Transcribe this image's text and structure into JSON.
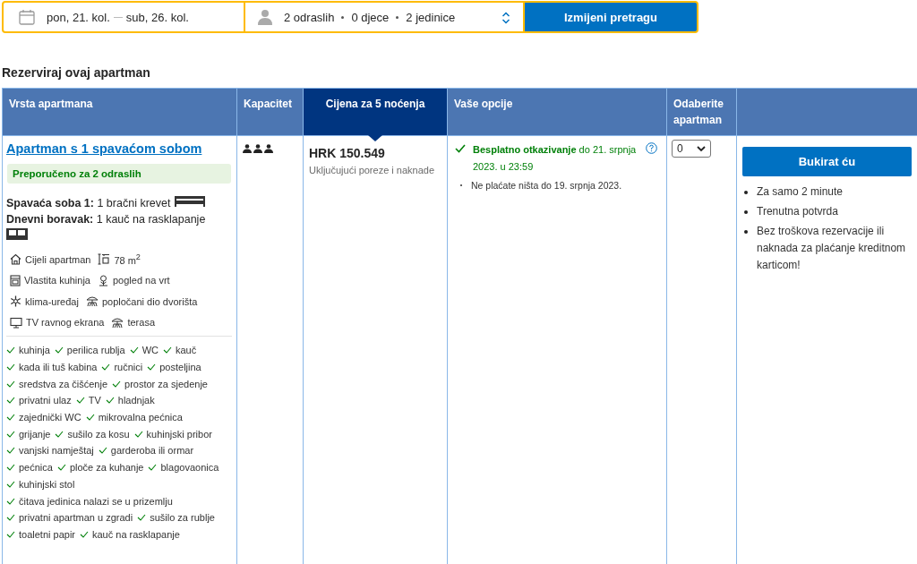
{
  "search_bar": {
    "dates": "pon, 21. kol.",
    "dates_end": "sub, 26. kol.",
    "guests": [
      "2 odraslih",
      "0 djece",
      "2 jedinice"
    ],
    "button": "Izmijeni pretragu"
  },
  "heading": "Rezerviraj ovaj apartman",
  "table": {
    "columns": [
      {
        "label": "Vrsta apartmana",
        "selected": false
      },
      {
        "label": "Kapacitet",
        "selected": false
      },
      {
        "label": "Cijena za 5 noćenja",
        "selected": true
      },
      {
        "label": "Vaše opcije",
        "selected": false
      },
      {
        "label": "Odaberite apartman",
        "selected": false
      }
    ],
    "room": {
      "name": "Apartman s 1 spavaćom sobom",
      "recommendation": "Preporučeno za 2 odraslih",
      "beds": [
        {
          "text": "**Spavaća soba 1:** 1 bračni krevet",
          "kind": "bed"
        },
        {
          "text": "**Dnevni boravak:** 1 kauč na rasklapanje",
          "kind": "sofa"
        }
      ],
      "features": [
        [
          {
            "kind": "house",
            "label": "Cijeli apartman"
          },
          {
            "kind": "size",
            "label": "78 m$^{2}$"
          }
        ],
        [
          {
            "kind": "kitchen",
            "label": "Vlastita kuhinja"
          },
          {
            "kind": "garden",
            "label": "pogled na vrt"
          }
        ],
        [
          {
            "kind": "snow",
            "label": "klima-uređaj"
          },
          {
            "kind": "patio",
            "label": "popločani dio dvorišta"
          }
        ],
        [
          {
            "kind": "tv",
            "label": "TV ravnog ekrana"
          },
          {
            "kind": "patio",
            "label": "terasa"
          }
        ]
      ],
      "amenities": [
        [
          "kuhinja",
          "perilica rublja",
          "WC",
          "kauč"
        ],
        [
          "kada ili tuš kabina",
          "ručnici",
          "posteljina"
        ],
        [
          "sredstva za čišćenje",
          "prostor za sjedenje"
        ],
        [
          "privatni ulaz",
          "TV",
          "hladnjak"
        ],
        [
          "zajednički WC",
          "mikrovalna pećnica"
        ],
        [
          "grijanje",
          "sušilo za kosu",
          "kuhinjski pribor"
        ],
        [
          "vanjski namještaj",
          "garderoba ili ormar"
        ],
        [
          "pećnica",
          "ploče za kuhanje",
          "blagovaonica"
        ],
        [
          "kuhinjski stol"
        ],
        [
          "čitava jedinica nalazi se u prizemlju"
        ],
        [
          "privatni apartman u zgradi",
          "sušilo za rublje"
        ],
        [
          "toaletni papir",
          "kauč na rasklapanje"
        ]
      ],
      "price": "HRK 150.549",
      "price_note": "Uključujući poreze i naknade",
      "cancellation": "**Besplatno otkazivanje** do 21. srpnja 2023. u 23:59",
      "payment_note": "Ne plaćate ništa do 19. srpnja 2023.",
      "quantity": "0",
      "book_button": "Bukirat ću",
      "benefits": [
        "Za samo 2 minute",
        "Trenutna potvrda",
        "Bez troškova rezervacije ili naknada za plaćanje kreditnom karticom!"
      ]
    }
  }
}
